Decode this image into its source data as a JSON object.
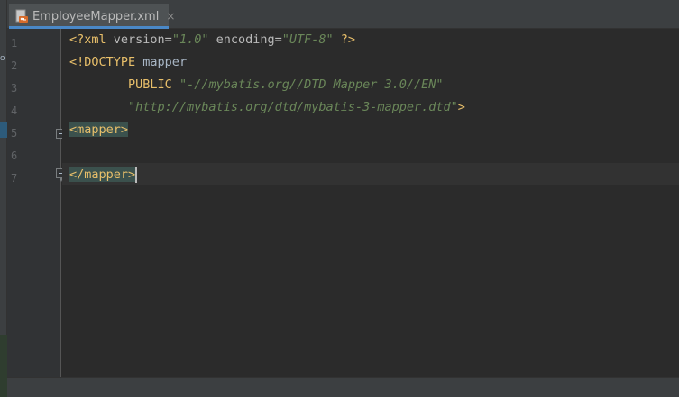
{
  "tab": {
    "title": "EmployeeMapper.xml",
    "close": "×",
    "icon": "xml-file-icon"
  },
  "gutter": {
    "line_numbers": [
      "1",
      "2",
      "3",
      "4",
      "5",
      "6",
      "7"
    ]
  },
  "tool_strip": {
    "mark": "o"
  },
  "code": {
    "l1": {
      "open": "<?",
      "tag": "xml",
      "attr1": " version=",
      "val1": "\"1.0\"",
      "attr2": " encoding=",
      "val2": "\"UTF-8\"",
      "close": " ?>"
    },
    "l2": {
      "open": "<!",
      "kw": "DOCTYPE",
      "name": " mapper"
    },
    "l3": {
      "indent": "        ",
      "kw": "PUBLIC",
      "space": " ",
      "val": "\"-//mybatis.org//DTD Mapper 3.0//EN\""
    },
    "l4": {
      "indent": "        ",
      "val": "\"http://mybatis.org/dtd/mybatis-3-mapper.dtd\"",
      "close": ">"
    },
    "l5": {
      "lt": "<",
      "name": "mapper",
      "gt": ">"
    },
    "l7": {
      "lt": "</",
      "name": "mapper",
      "gt": ">"
    }
  },
  "colors": {
    "background": "#2b2b2b",
    "gutter": "#313335",
    "tag": "#e8bf6a",
    "string": "#6a8759",
    "text": "#a9b7c6",
    "line_number": "#606366",
    "tag_match_highlight": "#3b514d"
  }
}
